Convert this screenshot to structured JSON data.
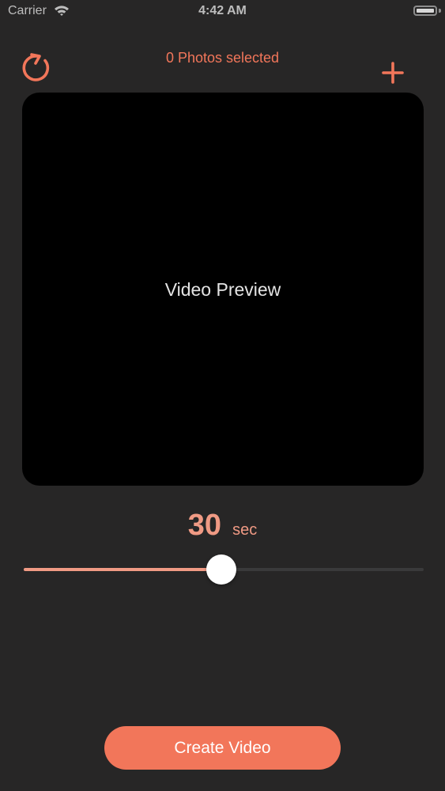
{
  "status_bar": {
    "carrier": "Carrier",
    "time": "4:42 AM"
  },
  "header": {
    "photo_count_label": "0 Photos selected"
  },
  "preview": {
    "label": "Video Preview"
  },
  "duration": {
    "value": "30",
    "unit": "sec",
    "slider_fraction": 0.495
  },
  "actions": {
    "create_label": "Create Video"
  },
  "colors": {
    "accent": "#f2765a",
    "accent_light": "#f09a84",
    "background": "#272626",
    "preview_bg": "#000000"
  },
  "icons": {
    "refresh": "refresh-icon",
    "add": "plus-icon",
    "wifi": "wifi-icon",
    "battery": "battery-icon"
  }
}
